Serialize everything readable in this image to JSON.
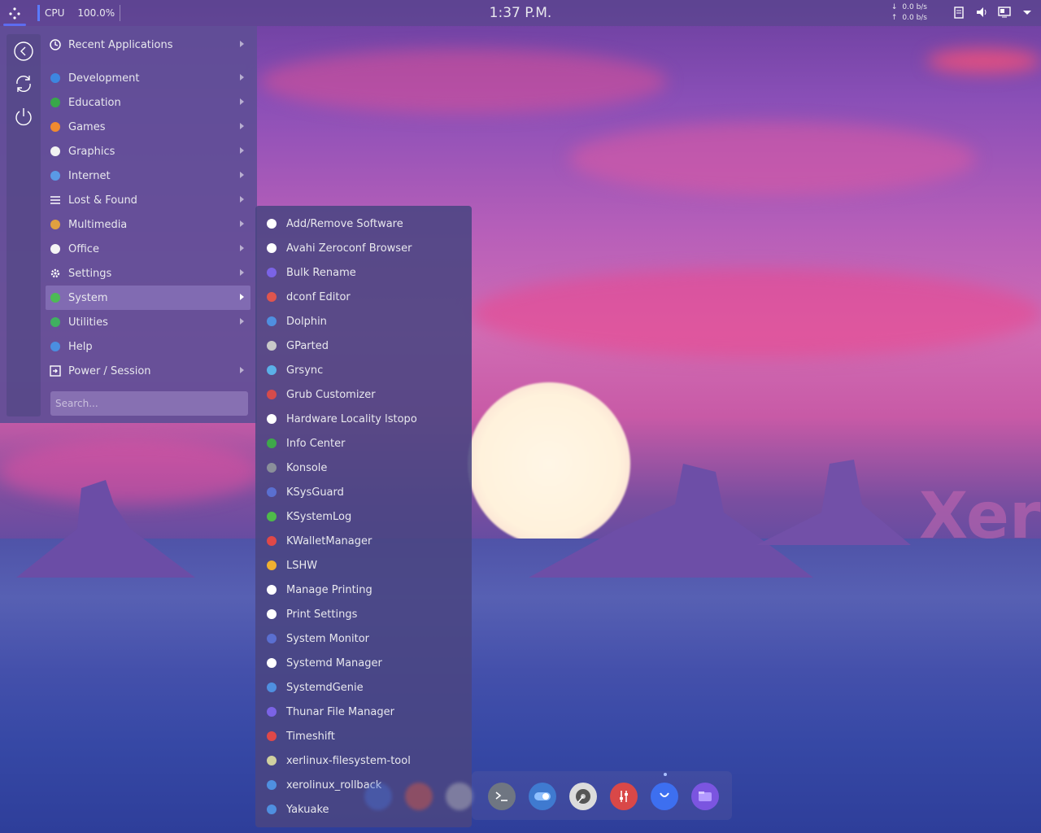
{
  "panel": {
    "cpu_label": "CPU",
    "cpu_value": "100.0%",
    "clock": "1:37 P.M.",
    "net_down": "0.0 b/s",
    "net_up": "0.0 b/s",
    "down_arrow": "↓",
    "up_arrow": "↑"
  },
  "menu": {
    "items": [
      {
        "label": "Recent Applications",
        "icon": "clock-icon"
      },
      {
        "label": "Development",
        "icon": "development-icon"
      },
      {
        "label": "Education",
        "icon": "education-icon"
      },
      {
        "label": "Games",
        "icon": "games-icon"
      },
      {
        "label": "Graphics",
        "icon": "graphics-icon"
      },
      {
        "label": "Internet",
        "icon": "internet-icon"
      },
      {
        "label": "Lost & Found",
        "icon": "list-icon"
      },
      {
        "label": "Multimedia",
        "icon": "multimedia-icon"
      },
      {
        "label": "Office",
        "icon": "office-icon"
      },
      {
        "label": "Settings",
        "icon": "settings-icon"
      },
      {
        "label": "System",
        "icon": "system-icon"
      },
      {
        "label": "Utilities",
        "icon": "utilities-icon"
      },
      {
        "label": "Help",
        "icon": "help-icon"
      },
      {
        "label": "Power / Session",
        "icon": "power-session-icon"
      }
    ],
    "search_placeholder": "Search..."
  },
  "submenu": {
    "items": [
      {
        "label": "Add/Remove Software",
        "color": "#ffffff"
      },
      {
        "label": "Avahi Zeroconf Browser",
        "color": "#ffffff"
      },
      {
        "label": "Bulk Rename",
        "color": "#7b63e6"
      },
      {
        "label": "dconf Editor",
        "color": "#e0554e"
      },
      {
        "label": "Dolphin",
        "color": "#4f8fe0"
      },
      {
        "label": "GParted",
        "color": "#c9c9c9"
      },
      {
        "label": "Grsync",
        "color": "#5bb0e8"
      },
      {
        "label": "Grub Customizer",
        "color": "#d64b4b"
      },
      {
        "label": "Hardware Locality lstopo",
        "color": "#ffffff"
      },
      {
        "label": "Info Center",
        "color": "#3ea84a"
      },
      {
        "label": "Konsole",
        "color": "#8a8f9a"
      },
      {
        "label": "KSysGuard",
        "color": "#5a6fd0"
      },
      {
        "label": "KSystemLog",
        "color": "#4fba4a"
      },
      {
        "label": "KWalletManager",
        "color": "#e04848"
      },
      {
        "label": "LSHW",
        "color": "#f0b030"
      },
      {
        "label": "Manage Printing",
        "color": "#ffffff"
      },
      {
        "label": "Print Settings",
        "color": "#ffffff"
      },
      {
        "label": "System Monitor",
        "color": "#5a6fd0"
      },
      {
        "label": "Systemd Manager",
        "color": "#ffffff"
      },
      {
        "label": "SystemdGenie",
        "color": "#4f8fe0"
      },
      {
        "label": "Thunar File Manager",
        "color": "#7b63e6"
      },
      {
        "label": "Timeshift",
        "color": "#e04848"
      },
      {
        "label": "xerlinux-filesystem-tool",
        "color": "#d0d0a0"
      },
      {
        "label": "xerolinux_rollback",
        "color": "#4f8fe0"
      },
      {
        "label": "Yakuake",
        "color": "#4f8fe0"
      }
    ]
  },
  "dock": {
    "items": [
      "terminal-icon",
      "toggle-icon",
      "disk-icon",
      "mixer-icon",
      "store-icon",
      "folder-icon"
    ]
  },
  "wallpaper": {
    "watermark": "Xer"
  }
}
